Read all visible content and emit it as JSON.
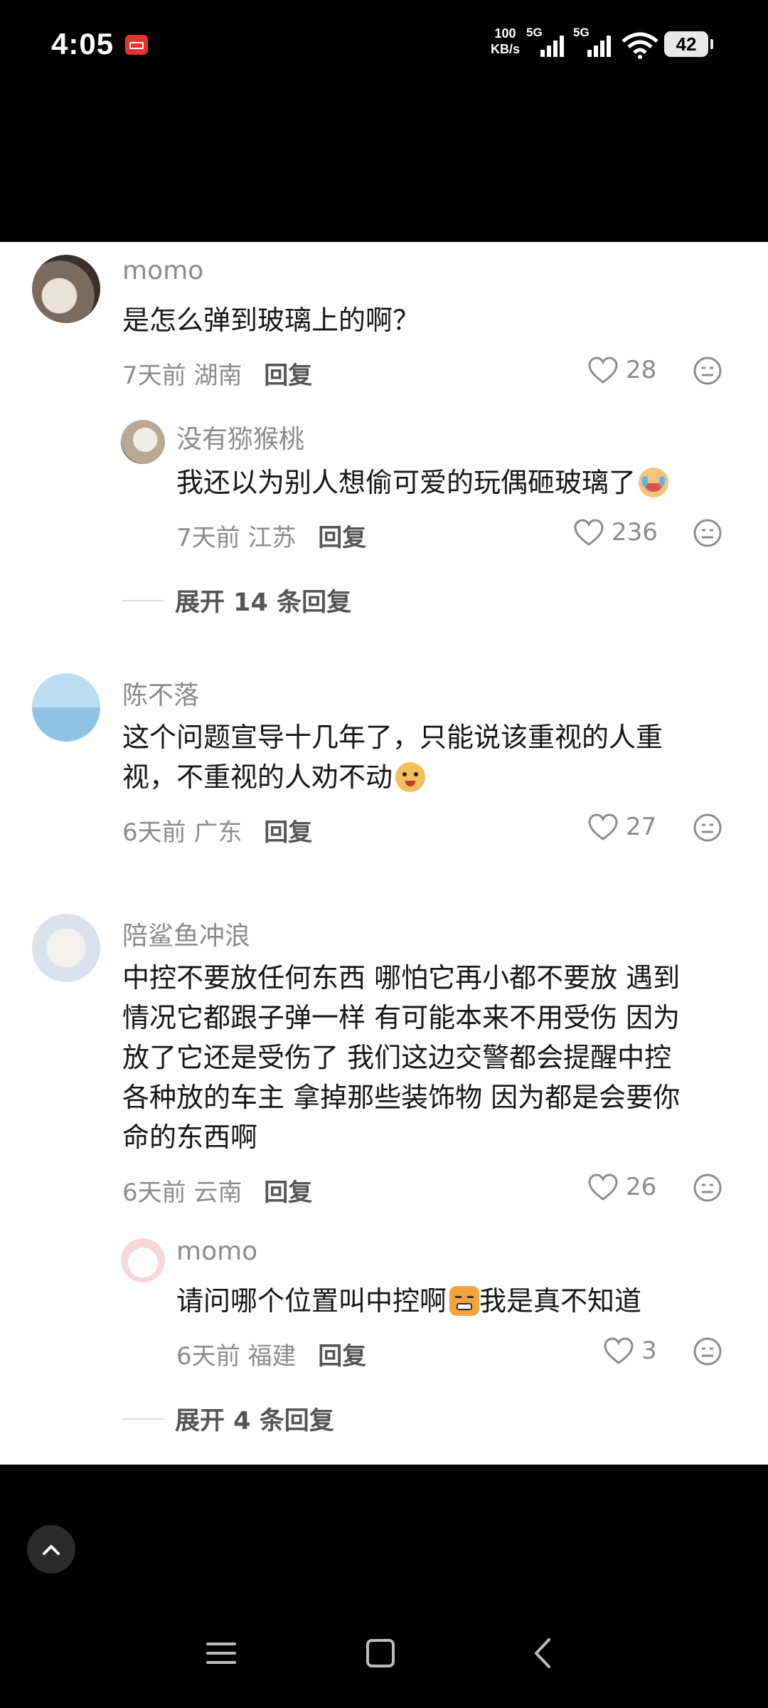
{
  "status_bar": {
    "time": "4:05",
    "speed_value": "100",
    "speed_unit": "KB/s",
    "signal1": "5G",
    "signal2": "5G",
    "battery": "42"
  },
  "comments": [
    {
      "username": "momo",
      "text": "是怎么弹到玻璃上的啊？",
      "time": "7天前",
      "location": "湖南",
      "reply_label": "回复",
      "likes": "28"
    },
    {
      "username": "没有猕猴桃",
      "text": "我还以为别人想偷可爱的玩偶砸玻璃了",
      "time": "7天前",
      "location": "江苏",
      "reply_label": "回复",
      "likes": "236"
    },
    {
      "username": "陈不落",
      "text_line1": "这个问题宣导十几年了，只能说该重视的人重",
      "text_line2": "视，不重视的人劝不动",
      "time": "6天前",
      "location": "广东",
      "reply_label": "回复",
      "likes": "27"
    },
    {
      "username": "陪鲨鱼冲浪",
      "lines": [
        "中控不要放任何东西 哪怕它再小都不要放 遇到",
        "情况它都跟子弹一样 有可能本来不用受伤 因为",
        "放了它还是受伤了 我们这边交警都会提醒中控",
        "各种放的车主 拿掉那些装饰物 因为都是会要你",
        "命的东西啊"
      ],
      "time": "6天前",
      "location": "云南",
      "reply_label": "回复",
      "likes": "26"
    },
    {
      "username": "momo",
      "text_part1": "请问哪个位置叫中控啊",
      "text_part2": "我是真不知道",
      "time": "6天前",
      "location": "福建",
      "reply_label": "回复",
      "likes": "3"
    }
  ],
  "expand_replies": [
    "展开 14 条回复",
    "展开 4 条回复"
  ],
  "icons": {
    "like": "heart-outline-icon",
    "dislike": "neutral-face-icon",
    "scroll_top": "chevron-up-icon",
    "nav_menu": "menu-icon",
    "nav_home": "square-icon",
    "nav_back": "chevron-left-icon"
  },
  "colors": {
    "background": "#000000",
    "panel": "#ffffff",
    "meta_gray": "#8c8c8c"
  }
}
